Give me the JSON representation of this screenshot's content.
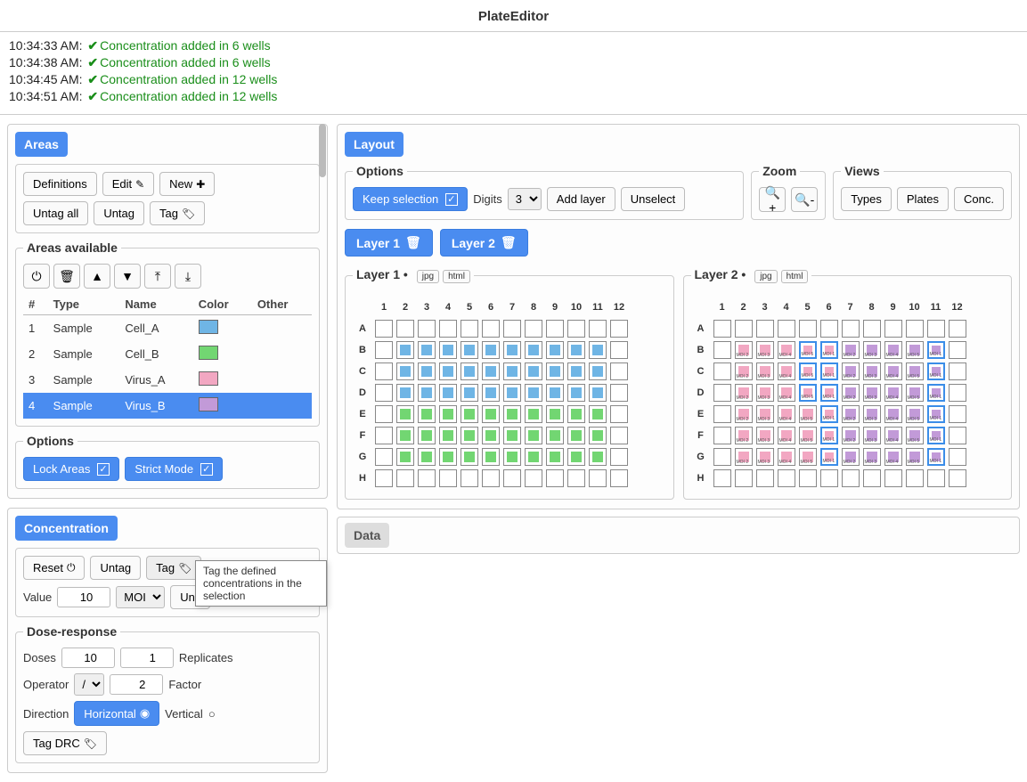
{
  "app": {
    "title": "PlateEditor"
  },
  "log": [
    {
      "time": "10:34:33 AM:",
      "msg": "Concentration added in 6 wells"
    },
    {
      "time": "10:34:38 AM:",
      "msg": "Concentration added in 6 wells"
    },
    {
      "time": "10:34:45 AM:",
      "msg": "Concentration added in 12 wells"
    },
    {
      "time": "10:34:51 AM:",
      "msg": "Concentration added in 12 wells"
    }
  ],
  "areas": {
    "header": "Areas",
    "buttons": {
      "definitions": "Definitions",
      "edit": "Edit",
      "new": "New",
      "untag_all": "Untag all",
      "untag": "Untag",
      "tag": "Tag"
    },
    "available_label": "Areas available",
    "table": {
      "headers": {
        "n": "#",
        "type": "Type",
        "name": "Name",
        "color": "Color",
        "other": "Other"
      },
      "rows": [
        {
          "n": "1",
          "type": "Sample",
          "name": "Cell_A",
          "color": "#6fb5e5",
          "selected": false
        },
        {
          "n": "2",
          "type": "Sample",
          "name": "Cell_B",
          "color": "#72d672",
          "selected": false
        },
        {
          "n": "3",
          "type": "Sample",
          "name": "Virus_A",
          "color": "#f2a7c2",
          "selected": false
        },
        {
          "n": "4",
          "type": "Sample",
          "name": "Virus_B",
          "color": "#c29ad8",
          "selected": true
        }
      ]
    },
    "options": {
      "label": "Options",
      "lock": "Lock Areas",
      "strict": "Strict Mode"
    }
  },
  "concentration": {
    "header": "Concentration",
    "buttons": {
      "reset": "Reset",
      "untag": "Untag",
      "tag": "Tag"
    },
    "value_label": "Value",
    "value": "10",
    "unit_select": "MOI",
    "unit_btn": "Unit",
    "dose": {
      "label": "Dose-response",
      "doses_label": "Doses",
      "doses": "10",
      "replicates_label": "Replicates",
      "replicates": "1",
      "operator_label": "Operator",
      "operator": "/",
      "factor_label": "Factor",
      "factor": "2",
      "direction_label": "Direction",
      "horizontal": "Horizontal",
      "vertical": "Vertical",
      "tag_drc": "Tag DRC"
    },
    "tooltip": "Tag the defined concentrations in the selection"
  },
  "layout": {
    "header": "Layout",
    "options": {
      "label": "Options",
      "keep": "Keep selection",
      "digits_label": "Digits",
      "digits": "3",
      "add_layer": "Add layer",
      "unselect": "Unselect"
    },
    "zoom": {
      "label": "Zoom"
    },
    "views": {
      "label": "Views",
      "types": "Types",
      "plates": "Plates",
      "conc": "Conc."
    },
    "tabs": {
      "layer1": "Layer 1",
      "layer2": "Layer 2"
    },
    "plate1": {
      "title": "Layer 1 •",
      "jpg": "jpg",
      "html": "html"
    },
    "plate2": {
      "title": "Layer 2 •",
      "jpg": "jpg",
      "html": "html"
    },
    "cols": [
      "1",
      "2",
      "3",
      "4",
      "5",
      "6",
      "7",
      "8",
      "9",
      "10",
      "11",
      "12"
    ],
    "rows": [
      "A",
      "B",
      "C",
      "D",
      "E",
      "F",
      "G",
      "H"
    ],
    "plate1_fill": {
      "A": [
        "",
        "",
        "",
        "",
        "",
        "",
        "",
        "",
        "",
        "",
        "",
        ""
      ],
      "B": [
        "",
        "blue",
        "blue",
        "blue",
        "blue",
        "blue",
        "blue",
        "blue",
        "blue",
        "blue",
        "blue",
        ""
      ],
      "C": [
        "",
        "blue",
        "blue",
        "blue",
        "blue",
        "blue",
        "blue",
        "blue",
        "blue",
        "blue",
        "blue",
        ""
      ],
      "D": [
        "",
        "blue",
        "blue",
        "blue",
        "blue",
        "blue",
        "blue",
        "blue",
        "blue",
        "blue",
        "blue",
        ""
      ],
      "E": [
        "",
        "green",
        "green",
        "green",
        "green",
        "green",
        "green",
        "green",
        "green",
        "green",
        "green",
        ""
      ],
      "F": [
        "",
        "green",
        "green",
        "green",
        "green",
        "green",
        "green",
        "green",
        "green",
        "green",
        "green",
        ""
      ],
      "G": [
        "",
        "green",
        "green",
        "green",
        "green",
        "green",
        "green",
        "green",
        "green",
        "green",
        "green",
        ""
      ],
      "H": [
        "",
        "",
        "",
        "",
        "",
        "",
        "",
        "",
        "",
        "",
        "",
        ""
      ]
    },
    "plate2_fill": {
      "A": [
        "",
        "",
        "",
        "",
        "",
        "",
        "",
        "",
        "",
        "",
        "",
        ""
      ],
      "B": [
        "",
        "pink",
        "pink",
        "pink",
        "pink",
        "pink",
        "purple",
        "purple",
        "purple",
        "purple",
        "purple",
        ""
      ],
      "C": [
        "",
        "pink",
        "pink",
        "pink",
        "pink",
        "pink",
        "purple",
        "purple",
        "purple",
        "purple",
        "purple",
        ""
      ],
      "D": [
        "",
        "pink",
        "pink",
        "pink",
        "pink",
        "pink",
        "purple",
        "purple",
        "purple",
        "purple",
        "purple",
        ""
      ],
      "E": [
        "",
        "pink",
        "pink",
        "pink",
        "pink",
        "pink",
        "purple",
        "purple",
        "purple",
        "purple",
        "purple",
        ""
      ],
      "F": [
        "",
        "pink",
        "pink",
        "pink",
        "pink",
        "pink",
        "purple",
        "purple",
        "purple",
        "purple",
        "purple",
        ""
      ],
      "G": [
        "",
        "pink",
        "pink",
        "pink",
        "pink",
        "pink",
        "purple",
        "purple",
        "purple",
        "purple",
        "purple",
        ""
      ],
      "H": [
        "",
        "",
        "",
        "",
        "",
        "",
        "",
        "",
        "",
        "",
        "",
        ""
      ]
    },
    "plate2_sel": {
      "B": [
        5,
        6,
        11
      ],
      "C": [
        5,
        6,
        11
      ],
      "D": [
        5,
        6,
        11
      ],
      "E": [
        6,
        11
      ],
      "F": [
        6,
        11
      ],
      "G": [
        6,
        11
      ]
    },
    "plate2_label": "MOI"
  },
  "data": {
    "header": "Data"
  }
}
